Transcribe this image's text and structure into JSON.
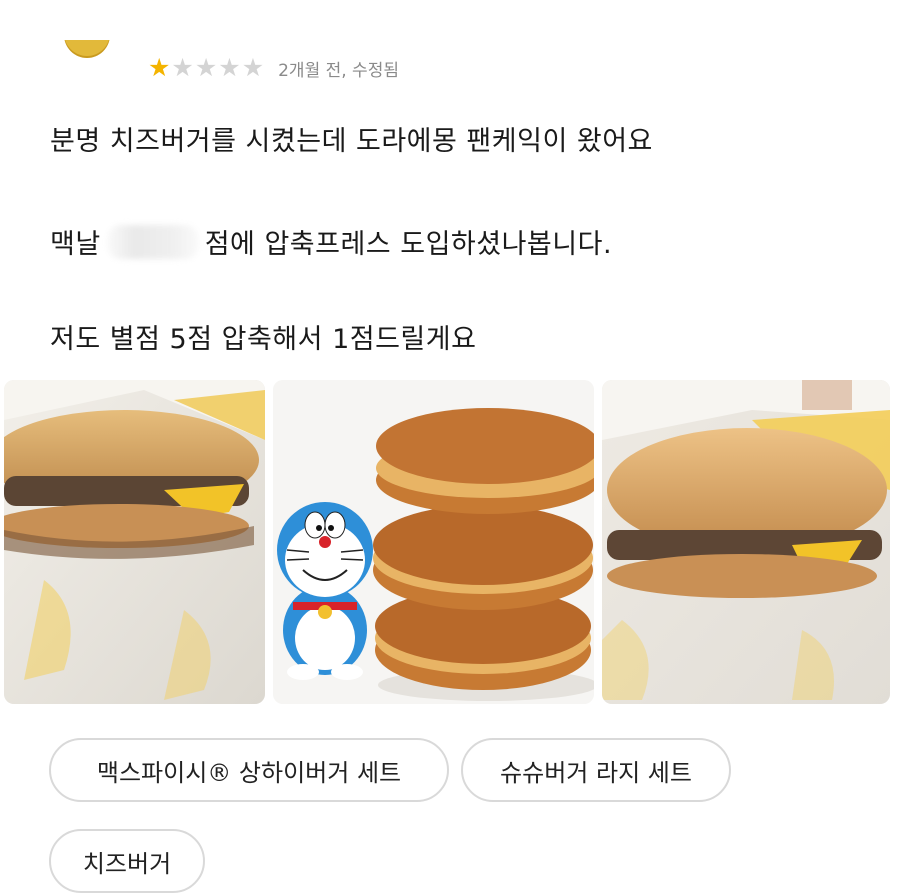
{
  "review": {
    "rating": 1,
    "max_rating": 5,
    "meta": "2개월 전, 수정됨",
    "line1": "분명 치즈버거를 시켰는데 도라에몽 팬케익이 왔어요",
    "line2_prefix": "맥날",
    "line2_suffix": "점에 압축프레스 도입하셨나봅니다.",
    "line3": "저도 별점 5점 압축해서 1점드릴게요"
  },
  "photos": [
    {
      "subject": "flattened-cheeseburger-photo"
    },
    {
      "subject": "doraemon-figure-with-dorayaki-photo"
    },
    {
      "subject": "flattened-cheeseburger-photo"
    }
  ],
  "ordered_items": [
    "맥스파이시® 상하이버거 세트",
    "슈슈버거 라지 세트",
    "치즈버거"
  ],
  "colors": {
    "star_on": "#f4b400",
    "star_off": "#d4d4d4",
    "meta": "#8a8a8a",
    "chip_border": "#d9d9d9"
  }
}
